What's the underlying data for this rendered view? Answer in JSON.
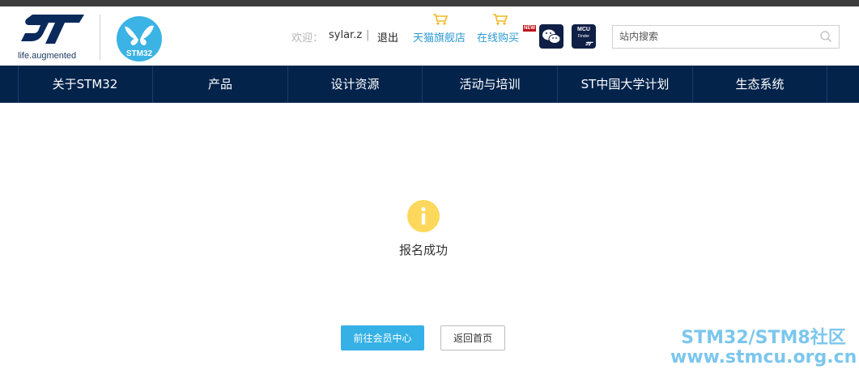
{
  "brand": {
    "st_tagline": "life.augmented",
    "stm32_label": "STM32"
  },
  "user": {
    "welcome_label": "欢迎：",
    "username": "sylar.z",
    "separator": "|",
    "logout_label": "退出"
  },
  "shops": [
    {
      "label": "天猫旗舰店",
      "icon": "cart-icon"
    },
    {
      "label": "在线购买",
      "icon": "cart-icon",
      "badge": "NEW"
    }
  ],
  "social": {
    "wechat_icon": "wechat-icon",
    "mcu_finder": {
      "title": "MCU",
      "subtitle": "Finder"
    }
  },
  "search": {
    "placeholder": "站内搜索",
    "icon": "search-icon"
  },
  "nav": {
    "items": [
      "关于STM32",
      "产品",
      "设计资源",
      "活动与培训",
      "ST中国大学计划",
      "生态系统"
    ]
  },
  "result": {
    "icon": "info-icon",
    "message": "报名成功",
    "primary_button": "前往会员中心",
    "secondary_button": "返回首页"
  },
  "watermark": {
    "line1": "STM32/STM8社区",
    "line2": "www.stmcu.org.cn"
  },
  "colors": {
    "nav_bg": "#03234b",
    "accent": "#35b1e6",
    "info_icon": "#fdd85c",
    "link": "#2c9ad6"
  }
}
